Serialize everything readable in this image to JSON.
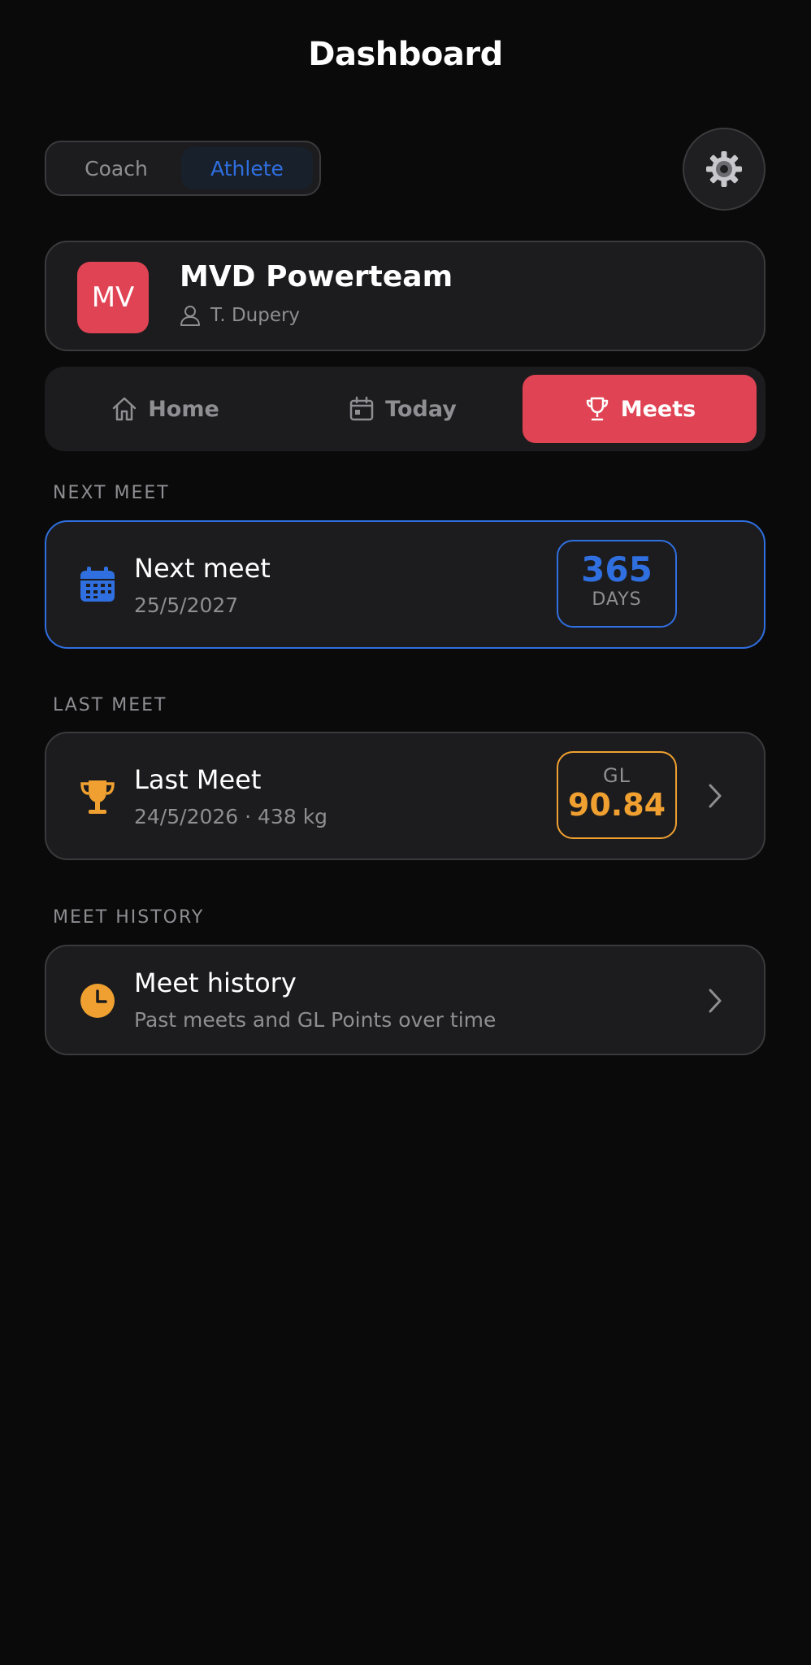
{
  "header": {
    "title": "Dashboard"
  },
  "role_toggle": {
    "coach_label": "Coach",
    "athlete_label": "Athlete",
    "selected": "Athlete"
  },
  "settings": {
    "icon": "gear-icon"
  },
  "team": {
    "initials": "MV",
    "name": "MVD Powerteam",
    "coach": "T. Dupery"
  },
  "tabs": [
    {
      "label": "Home",
      "icon": "home-icon"
    },
    {
      "label": "Today",
      "icon": "calendar-icon"
    },
    {
      "label": "Meets",
      "icon": "trophy-icon",
      "active": true
    }
  ],
  "next_meet": {
    "section_label": "NEXT MEET",
    "title": "Next meet",
    "date": "25/5/2027",
    "days_value": "365",
    "days_label": "DAYS"
  },
  "last_meet": {
    "section_label": "LAST MEET",
    "title": "Last Meet",
    "subtitle": "24/5/2026 · 438 kg",
    "gl_label": "GL",
    "gl_value": "90.84"
  },
  "meet_history": {
    "section_label": "MEET HISTORY",
    "title": "Meet history",
    "subtitle": "Past meets and GL Points over time"
  },
  "colors": {
    "accent_red": "#e04353",
    "accent_blue": "#2f6fe0",
    "accent_orange": "#f0a030",
    "background": "#0a0a0a",
    "card": "#1c1c1e"
  }
}
